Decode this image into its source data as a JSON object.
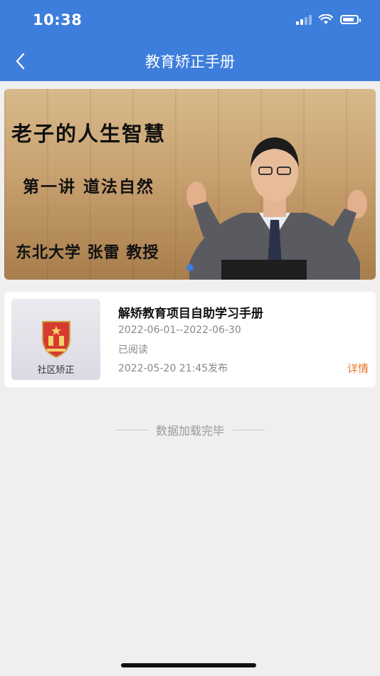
{
  "status_bar": {
    "time": "10:38"
  },
  "navbar": {
    "title": "教育矫正手册",
    "back_icon": "chevron-left-icon"
  },
  "banner": {
    "line1": "老子的人生智慧",
    "line2": "第一讲  道法自然",
    "line3": "东北大学 张雷 教授",
    "indicator_color": "#3d7ddb"
  },
  "card": {
    "thumb_label": "社区矫正",
    "title": "解矫教育项目自助学习手册",
    "date_range": "2022-06-01--2022-06-30",
    "read_status": "已阅读",
    "published": "2022-05-20 21:45发布",
    "details_label": "详情"
  },
  "footer": {
    "loaded_text": "数据加载完毕"
  },
  "colors": {
    "primary": "#3d7ddb",
    "accent": "#e8742a",
    "background": "#efefef"
  }
}
